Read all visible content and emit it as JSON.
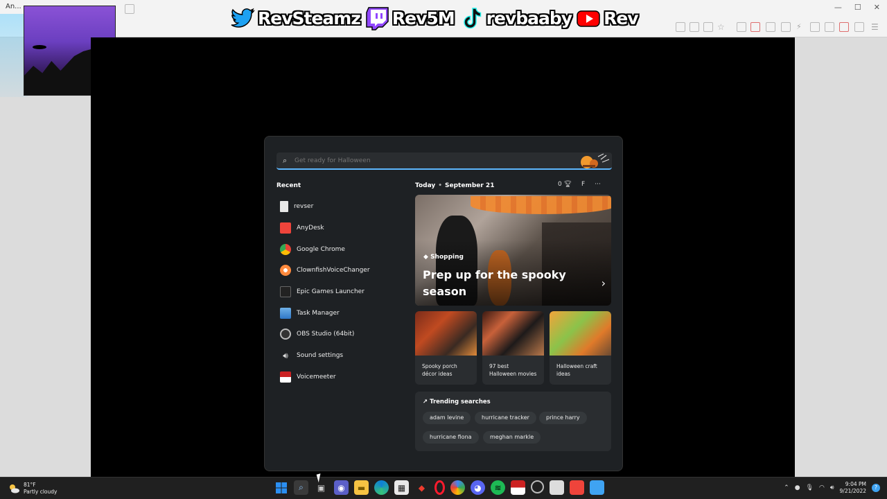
{
  "browser": {
    "tab_label": "An...",
    "window_controls": [
      "—",
      "☐",
      "✕"
    ]
  },
  "banner": {
    "twitter": "RevSteamz",
    "twitch": "Rev5M",
    "tiktok": "revbaaby",
    "youtube": "Rev"
  },
  "search": {
    "placeholder": "Get ready for Halloween"
  },
  "recent": {
    "title": "Recent",
    "items": [
      {
        "label": "revser",
        "icon": "file-icon"
      },
      {
        "label": "AnyDesk",
        "icon": "anydesk-icon"
      },
      {
        "label": "Google Chrome",
        "icon": "chrome-icon"
      },
      {
        "label": "ClownfishVoiceChanger",
        "icon": "clownfish-icon"
      },
      {
        "label": "Epic Games Launcher",
        "icon": "epic-icon"
      },
      {
        "label": "Task Manager",
        "icon": "task-manager-icon"
      },
      {
        "label": "OBS Studio (64bit)",
        "icon": "obs-icon"
      },
      {
        "label": "Sound settings",
        "icon": "speaker-icon"
      },
      {
        "label": "Voicemeeter",
        "icon": "voicemeeter-icon"
      }
    ]
  },
  "feed": {
    "today_label": "Today",
    "date": "September 21",
    "rewards_count": "0",
    "profile_initial": "F",
    "more": "···",
    "hero": {
      "tag": "Shopping",
      "headline": "Prep up for the spooky season"
    },
    "cards": [
      {
        "caption": "Spooky porch décor ideas"
      },
      {
        "caption": "97 best Halloween movies"
      },
      {
        "caption": "Halloween craft ideas"
      }
    ],
    "trending": {
      "title": "Trending searches",
      "chips": [
        "adam levine",
        "hurricane tracker",
        "prince harry",
        "hurricane fiona",
        "meghan markle"
      ]
    }
  },
  "taskbar": {
    "weather_temp": "81°F",
    "weather_desc": "Partly cloudy",
    "time": "9:04 PM",
    "date": "9/21/2022",
    "accent": "#5db7ff"
  }
}
